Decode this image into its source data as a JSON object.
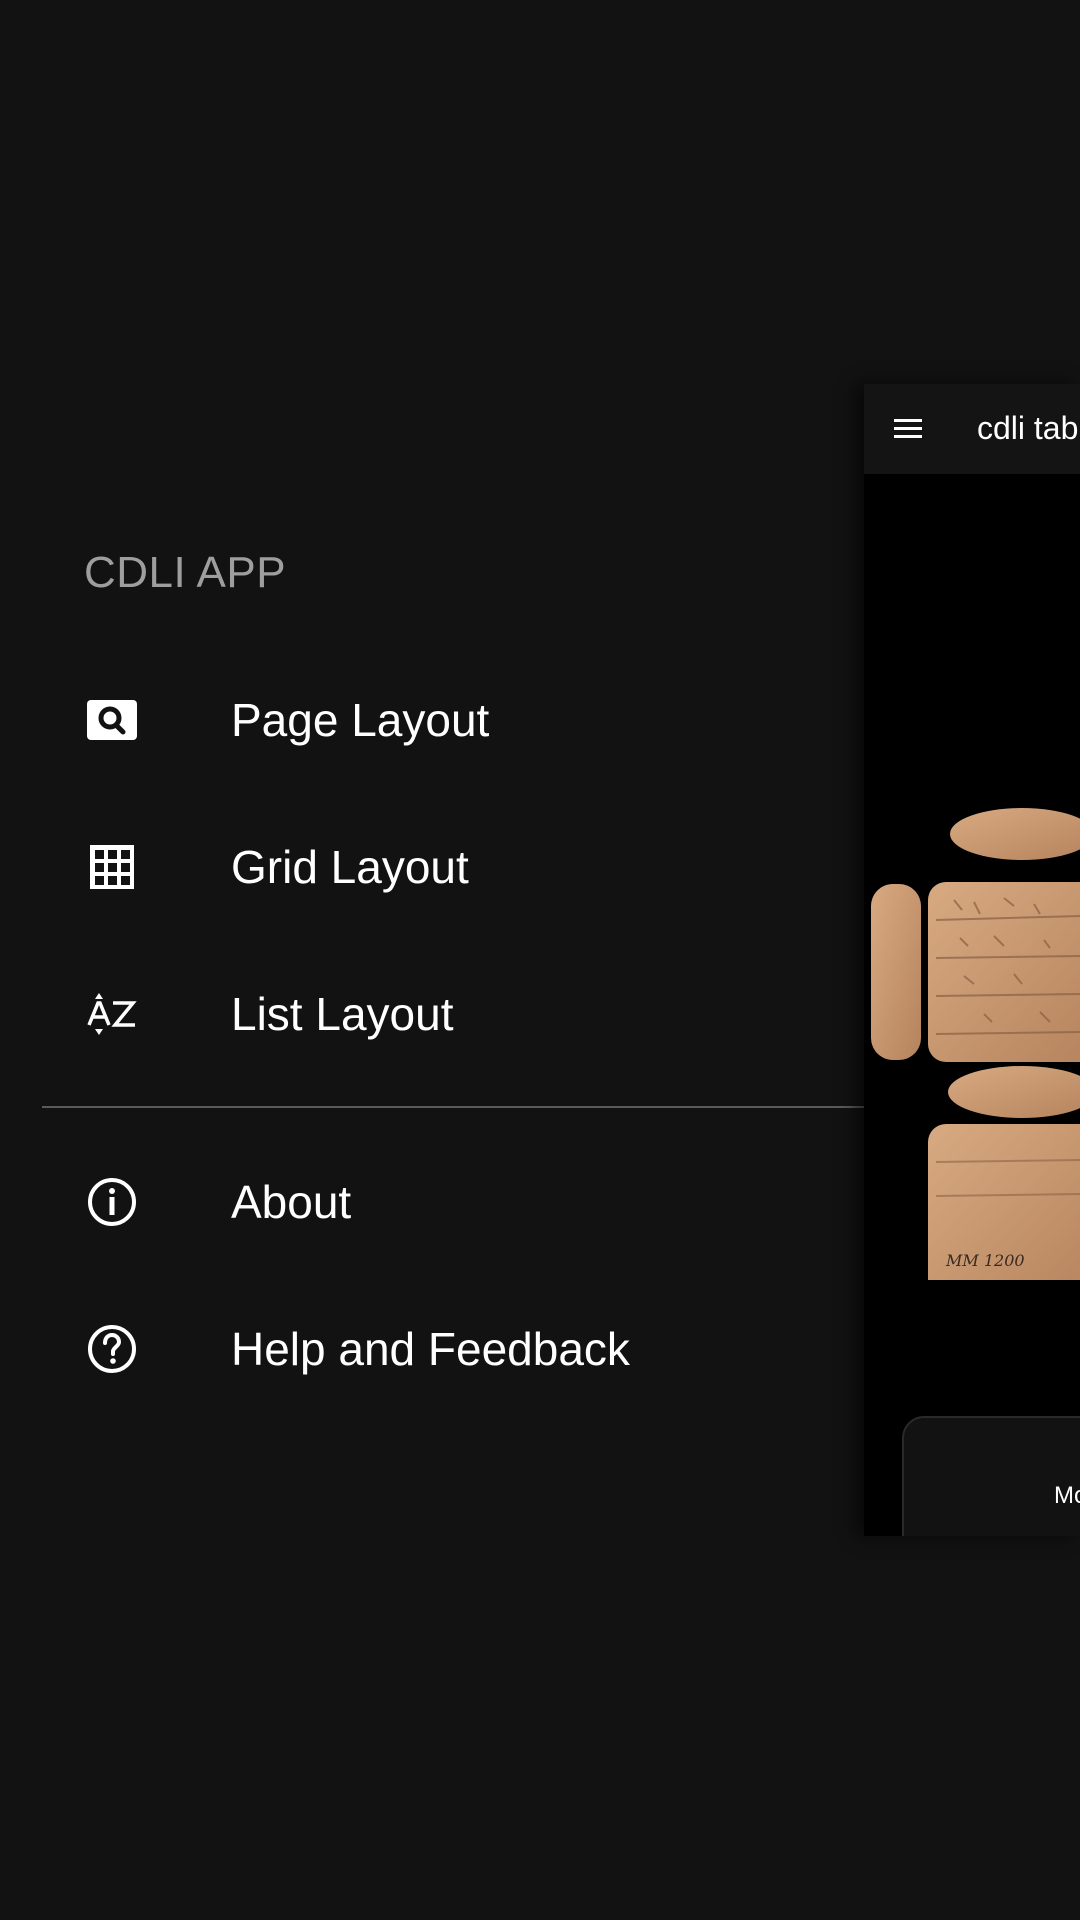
{
  "drawer": {
    "header": "CDLI APP",
    "items": [
      {
        "label": "Page Layout",
        "icon": "image-search-icon"
      },
      {
        "label": "Grid Layout",
        "icon": "grid-icon"
      },
      {
        "label": "List Layout",
        "icon": "sort-alpha-icon"
      },
      {
        "label": "About",
        "icon": "info-icon"
      },
      {
        "label": "Help and Feedback",
        "icon": "help-icon"
      }
    ]
  },
  "main": {
    "appbar_title": "cdli tab",
    "tablet_label": "MM 1200",
    "card_text": "Mo"
  },
  "colors": {
    "background": "#121212",
    "header_text": "#9e9e9e",
    "text": "#ffffff",
    "divider": "#5a5a5a",
    "tablet_clay": "#c99a72"
  }
}
